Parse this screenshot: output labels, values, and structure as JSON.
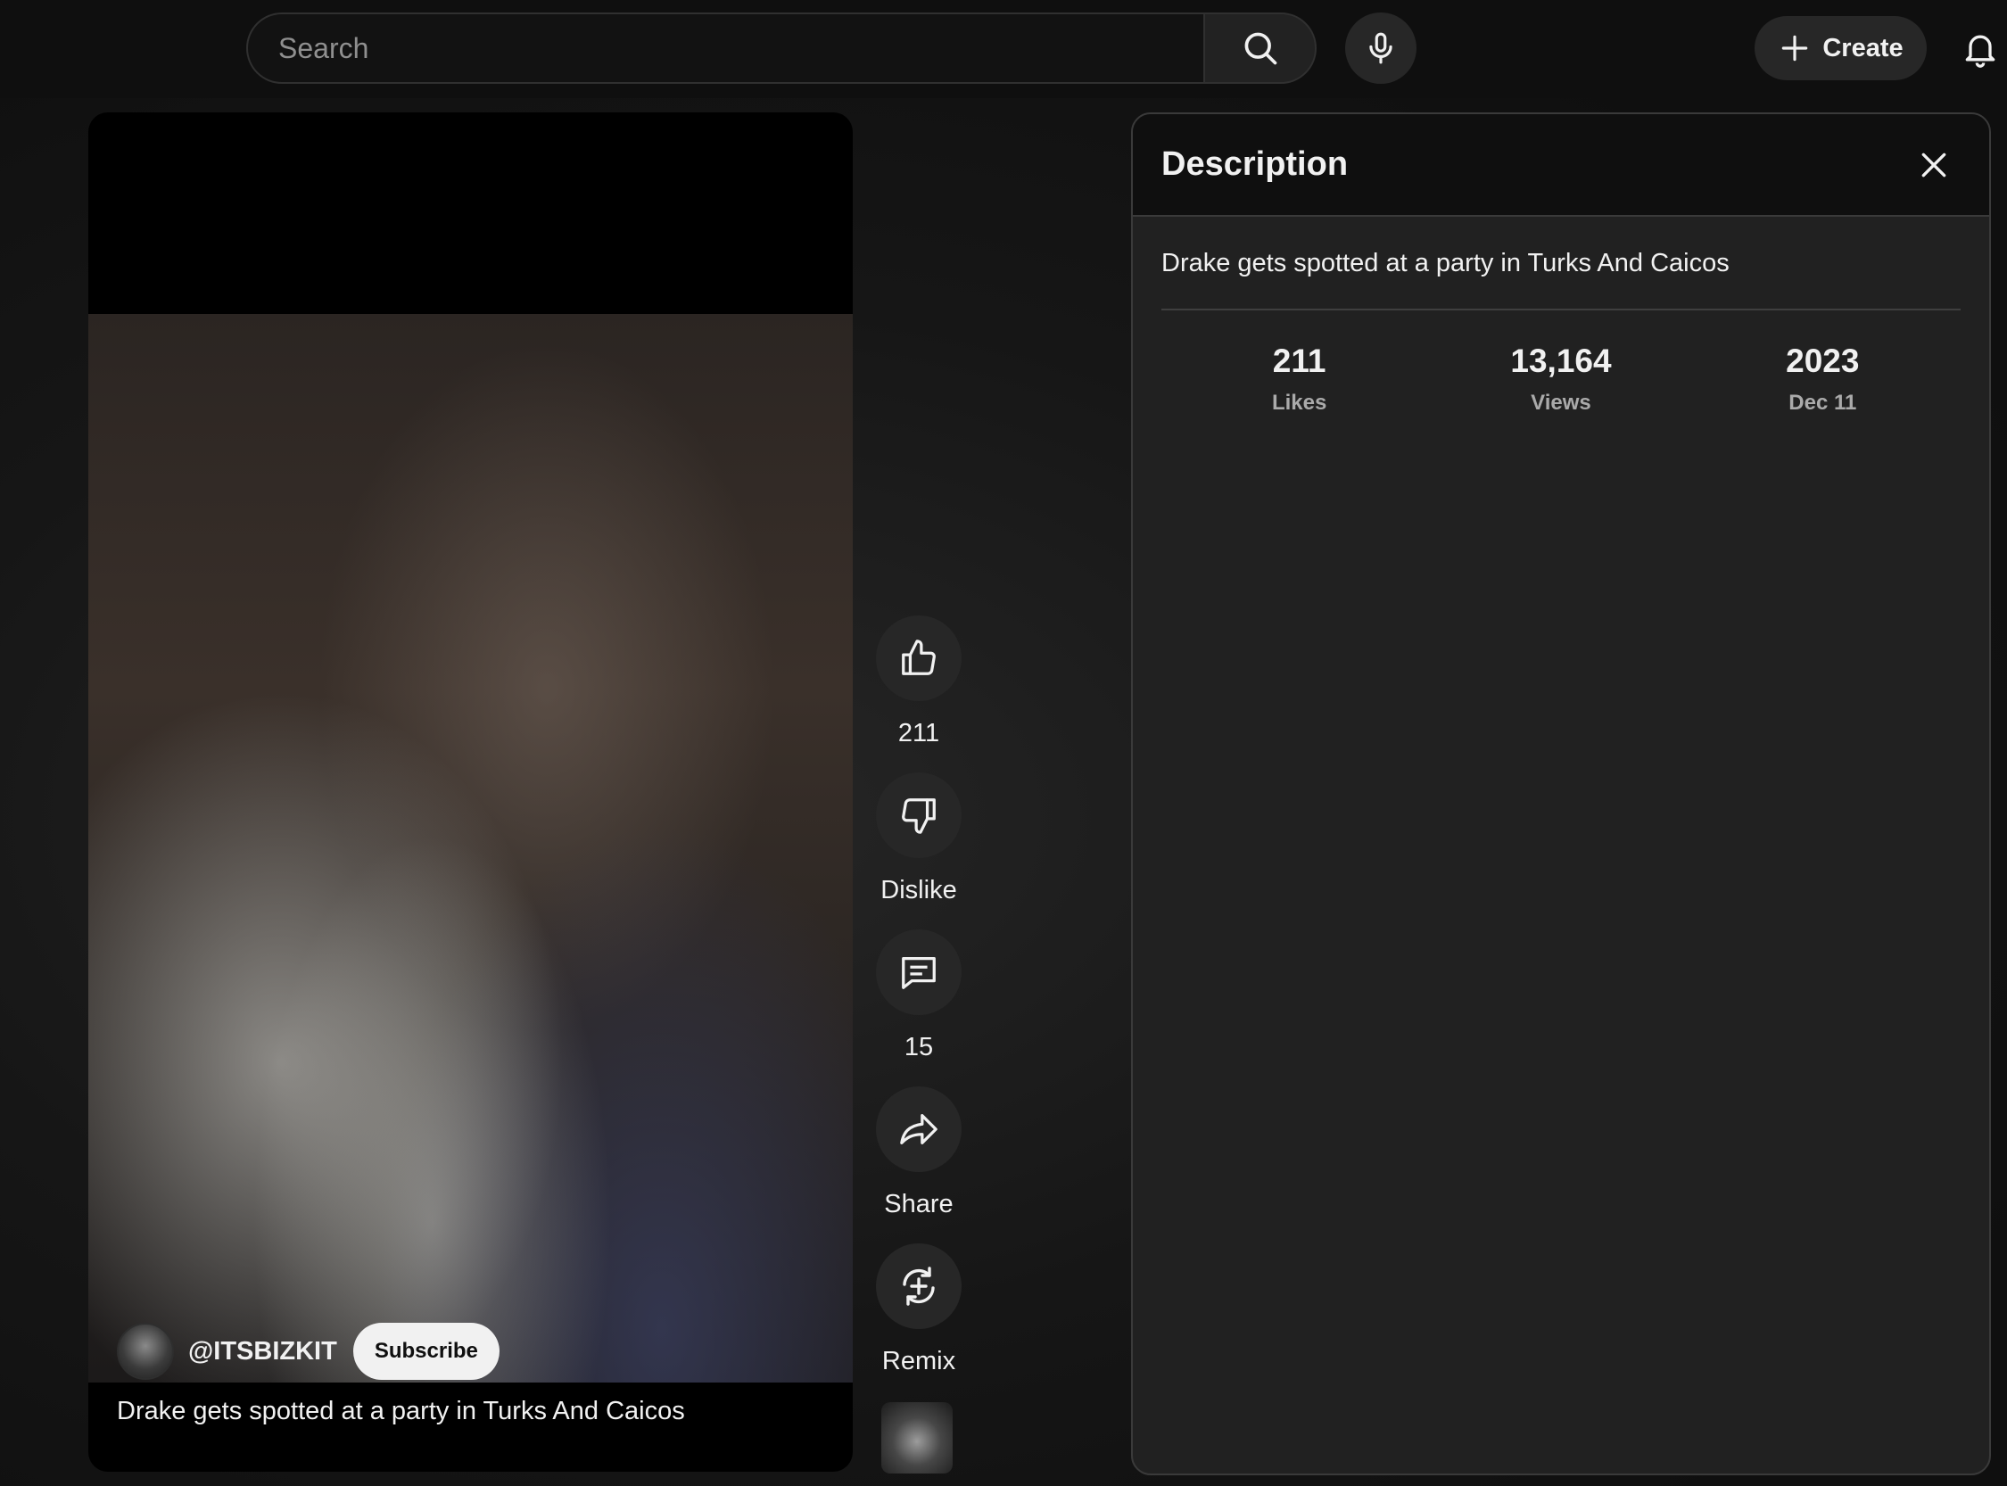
{
  "header": {
    "search": {
      "placeholder": "Search"
    },
    "create_label": "Create"
  },
  "video": {
    "channel": "@ITSBIZKIT",
    "subscribe_label": "Subscribe",
    "title": "Drake gets spotted at a party in Turks And Caicos"
  },
  "actions": {
    "like": {
      "label": "211",
      "icon": "thumbs-up-icon"
    },
    "dislike": {
      "label": "Dislike",
      "icon": "thumbs-down-icon"
    },
    "comments": {
      "label": "15",
      "icon": "comment-icon"
    },
    "share": {
      "label": "Share",
      "icon": "share-icon"
    },
    "remix": {
      "label": "Remix",
      "icon": "remix-icon"
    }
  },
  "description": {
    "title": "Description",
    "text": "Drake gets spotted at a party in Turks And Caicos",
    "stats": [
      {
        "value": "211",
        "label": "Likes"
      },
      {
        "value": "13,164",
        "label": "Views"
      },
      {
        "value": "2023",
        "label": "Dec 11"
      }
    ]
  }
}
